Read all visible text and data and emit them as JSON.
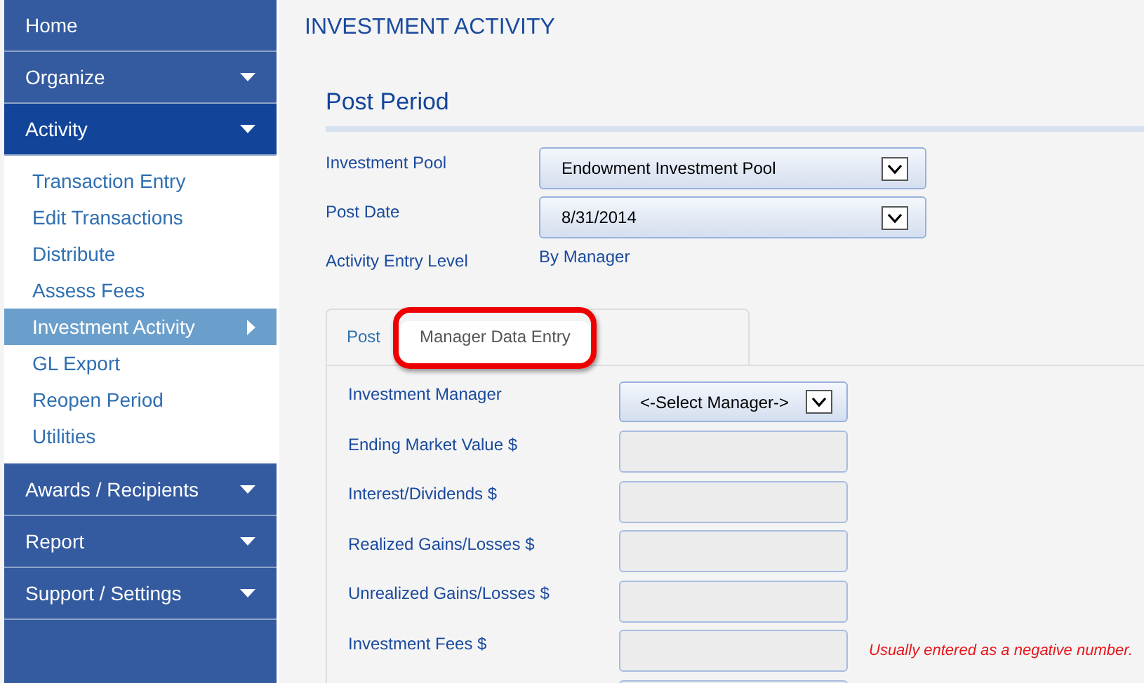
{
  "sidebar": {
    "items": [
      {
        "label": "Home",
        "kind": "link",
        "expanded": false
      },
      {
        "label": "Organize",
        "kind": "menu",
        "expanded": false
      },
      {
        "label": "Activity",
        "kind": "menu",
        "expanded": true,
        "children": [
          {
            "label": "Transaction Entry",
            "selected": false
          },
          {
            "label": "Edit Transactions",
            "selected": false
          },
          {
            "label": "Distribute",
            "selected": false
          },
          {
            "label": "Assess Fees",
            "selected": false
          },
          {
            "label": "Investment Activity",
            "selected": true
          },
          {
            "label": "GL Export",
            "selected": false
          },
          {
            "label": "Reopen Period",
            "selected": false
          },
          {
            "label": "Utilities",
            "selected": false
          }
        ]
      },
      {
        "label": "Awards / Recipients",
        "kind": "menu",
        "expanded": false
      },
      {
        "label": "Report",
        "kind": "menu",
        "expanded": false
      },
      {
        "label": "Support / Settings",
        "kind": "menu",
        "expanded": false
      }
    ]
  },
  "page_title": "INVESTMENT ACTIVITY",
  "section_title": "Post Period",
  "form": [
    {
      "label": "Investment Pool",
      "kind": "select",
      "value": "Endowment Investment Pool"
    },
    {
      "label": "Post Date",
      "kind": "select",
      "value": "8/31/2014"
    },
    {
      "label": "Activity Entry Level",
      "kind": "text",
      "value": "By Manager"
    }
  ],
  "tabs": [
    {
      "label": "Post",
      "selected": false,
      "highlighted": false
    },
    {
      "label": "Manager Data Entry",
      "selected": true,
      "highlighted": true
    }
  ],
  "manager_form": [
    {
      "label": "Investment Manager",
      "kind": "select",
      "value": "<-Select Manager->"
    },
    {
      "label": "Ending Market Value $",
      "kind": "input"
    },
    {
      "label": "Interest/Dividends $",
      "kind": "input"
    },
    {
      "label": "Realized Gains/Losses $",
      "kind": "input"
    },
    {
      "label": "Unrealized Gains/Losses $",
      "kind": "input"
    },
    {
      "label": "Investment Fees $",
      "kind": "input",
      "note": "Usually entered as a negative number."
    },
    {
      "kind": "input"
    }
  ]
}
